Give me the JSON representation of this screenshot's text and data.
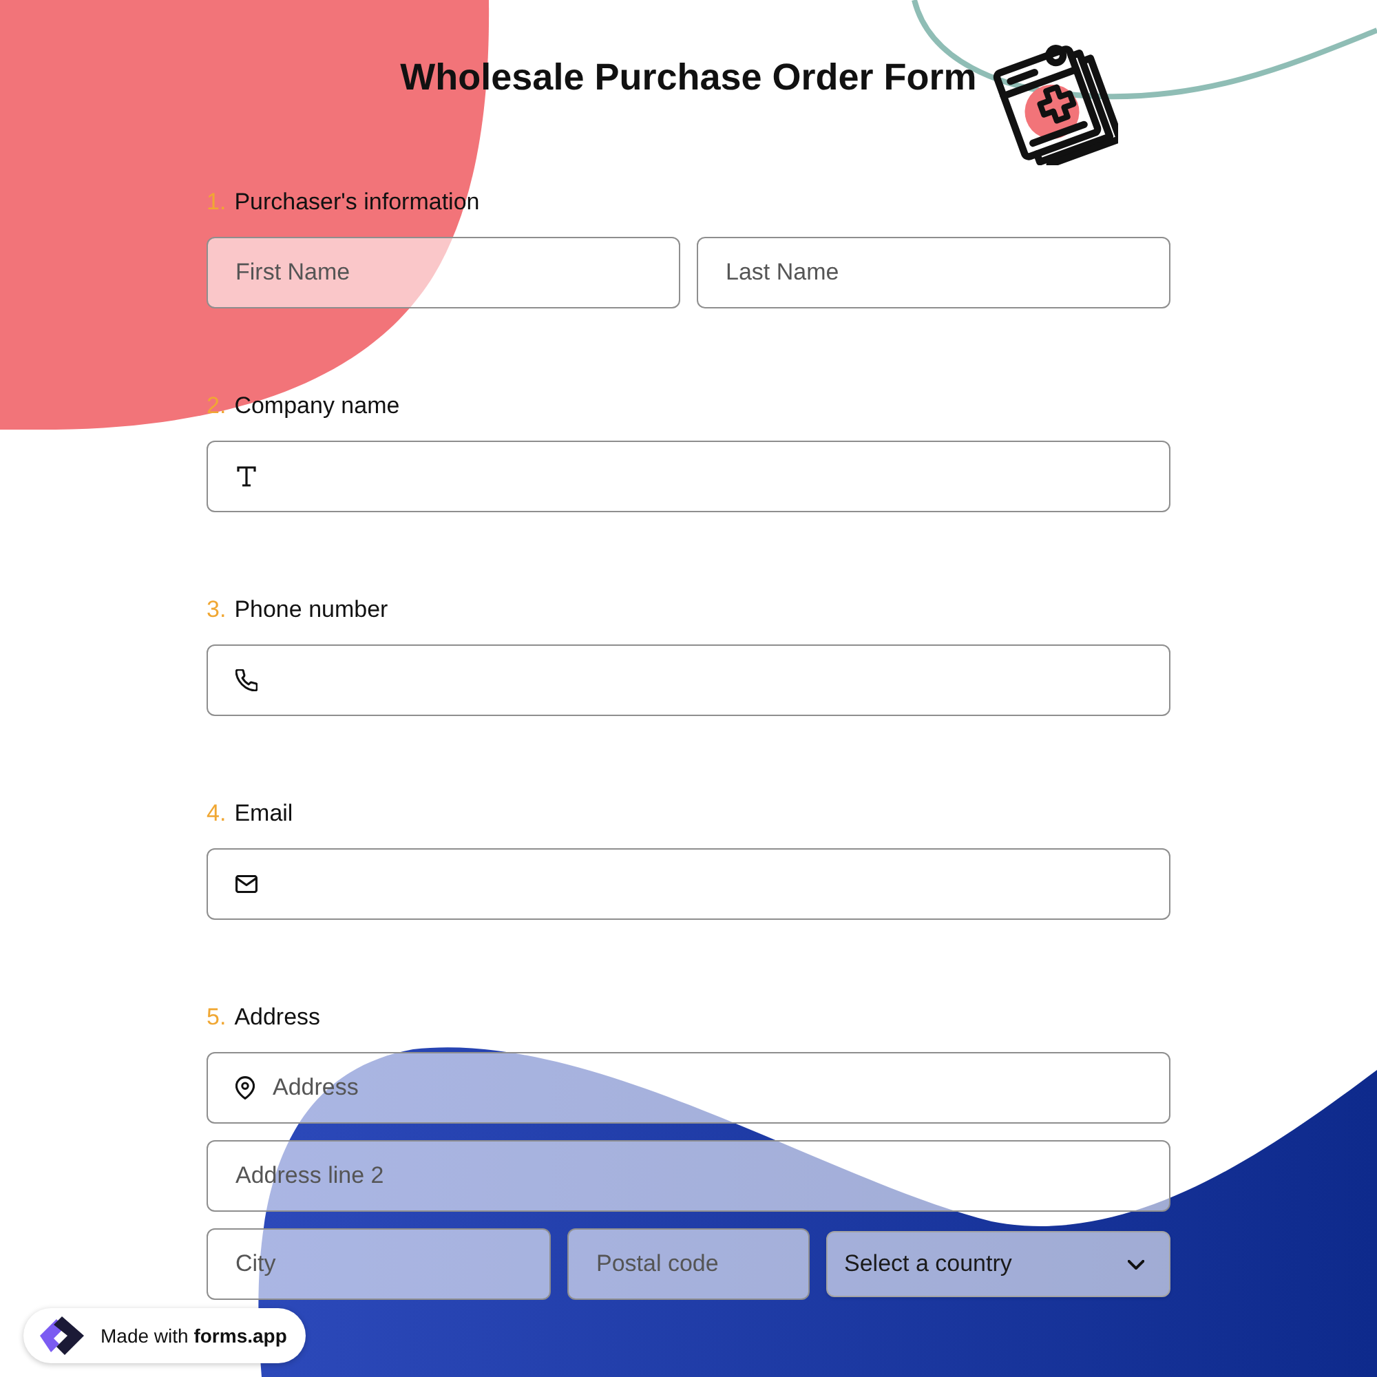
{
  "title": "Wholesale Purchase Order Form",
  "questions": [
    {
      "number": "1.",
      "label": "Purchaser's information",
      "rows": [
        [
          {
            "kind": "plain",
            "placeholder": "First Name"
          },
          {
            "kind": "plain",
            "placeholder": "Last Name"
          }
        ]
      ]
    },
    {
      "number": "2.",
      "label": "Company name",
      "rows": [
        [
          {
            "kind": "text"
          }
        ]
      ]
    },
    {
      "number": "3.",
      "label": "Phone number",
      "rows": [
        [
          {
            "kind": "phone"
          }
        ]
      ]
    },
    {
      "number": "4.",
      "label": "Email",
      "rows": [
        [
          {
            "kind": "email"
          }
        ]
      ]
    },
    {
      "number": "5.",
      "label": "Address",
      "rows": [
        [
          {
            "kind": "address",
            "placeholder": "Address"
          }
        ],
        [
          {
            "kind": "plain",
            "placeholder": "Address line 2"
          }
        ],
        [
          {
            "kind": "plain",
            "placeholder": "City"
          },
          {
            "kind": "plain",
            "placeholder": "Postal code"
          },
          {
            "kind": "select",
            "value": "Select a country"
          }
        ]
      ]
    }
  ],
  "badge": {
    "text": "Made with **forms.app**"
  }
}
